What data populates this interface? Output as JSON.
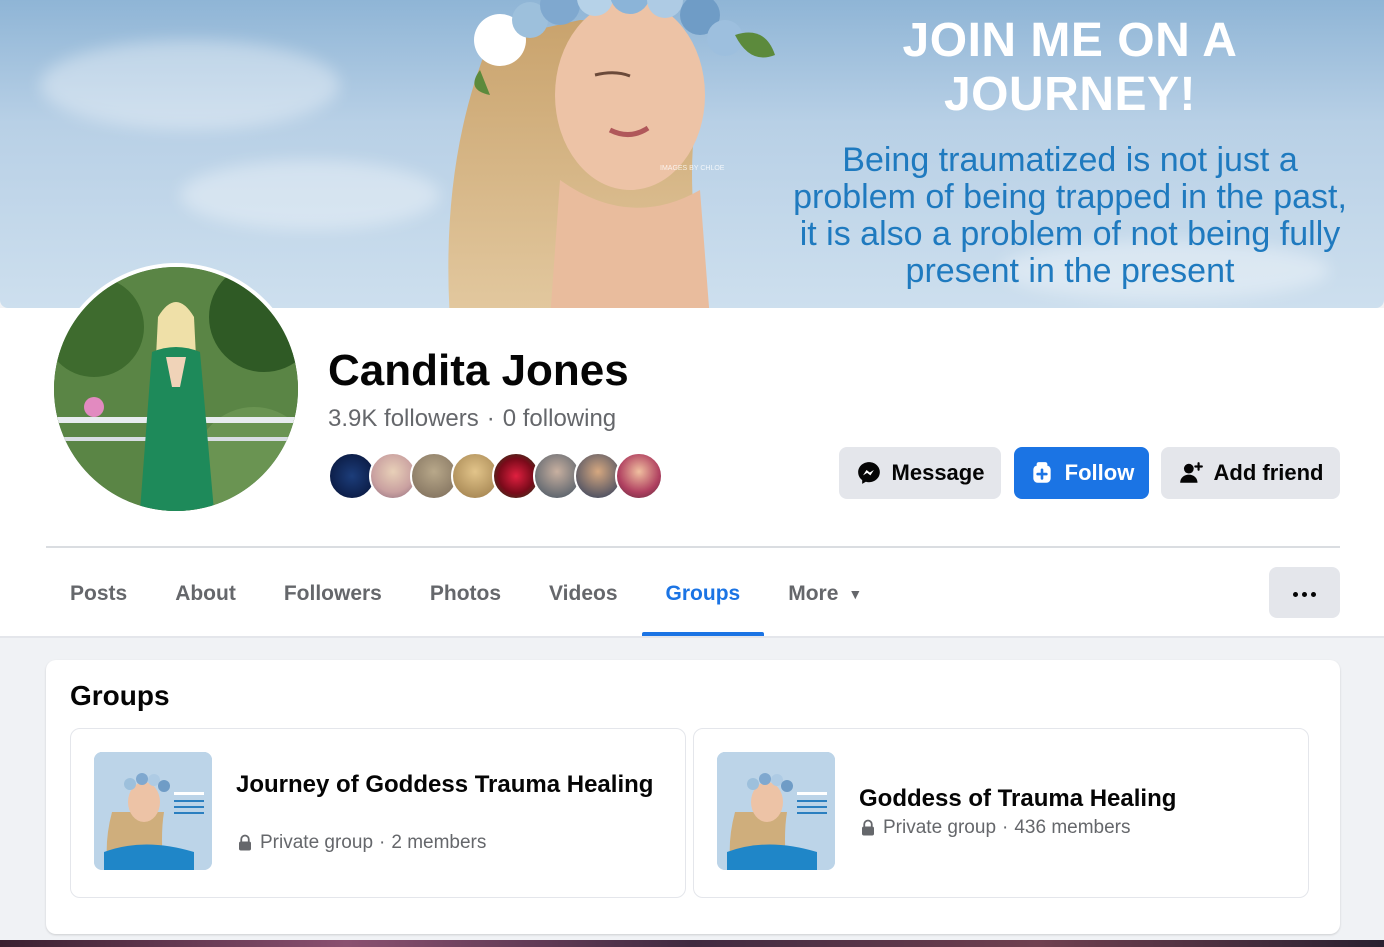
{
  "cover": {
    "headline": "JOIN ME ON A JOURNEY!",
    "quote": "Being traumatized is not just a problem of being trapped in the past, it is also a problem of not being fully present in the present",
    "watermark": "IMAGES BY CHLOE",
    "colors": {
      "headline": "#ffffff",
      "quote": "#1f7abf",
      "sky": "#b8d0e6"
    }
  },
  "profile": {
    "name": "Candita Jones",
    "followers": "3.9K followers",
    "separator": "·",
    "following": "0 following"
  },
  "actions": {
    "message": "Message",
    "follow": "Follow",
    "add_friend": "Add friend"
  },
  "tabs": [
    {
      "label": "Posts",
      "active": false
    },
    {
      "label": "About",
      "active": false
    },
    {
      "label": "Followers",
      "active": false
    },
    {
      "label": "Photos",
      "active": false
    },
    {
      "label": "Videos",
      "active": false
    },
    {
      "label": "Groups",
      "active": true
    },
    {
      "label": "More",
      "active": false
    }
  ],
  "groups_section": {
    "title": "Groups",
    "items": [
      {
        "name": "Journey of Goddess Trauma Healing",
        "privacy": "Private group",
        "dot": "·",
        "members": "2 members"
      },
      {
        "name": "Goddess of Trauma Healing",
        "privacy": "Private group",
        "dot": "·",
        "members": "436 members"
      }
    ]
  },
  "icons": {
    "message": "messenger-icon",
    "follow": "follow-icon",
    "add_friend": "add-person-icon",
    "more_caret": "caret-down-icon",
    "options": "more-dots-icon",
    "lock": "lock-icon"
  },
  "accent": "#1b74e4"
}
